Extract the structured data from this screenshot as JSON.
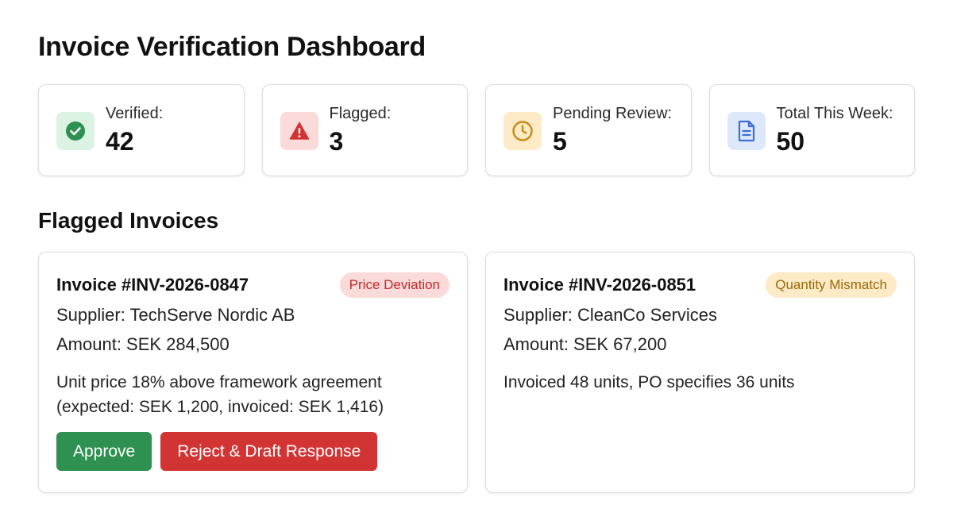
{
  "page": {
    "title": "Invoice Verification Dashboard"
  },
  "stats": [
    {
      "label": "Verified:",
      "value": "42",
      "icon": "check-circle-icon",
      "icon_bg": "#dcf2e3",
      "icon_color": "#2e9152"
    },
    {
      "label": "Flagged:",
      "value": "3",
      "icon": "warning-triangle-icon",
      "icon_bg": "#fbdada",
      "icon_color": "#d23434"
    },
    {
      "label": "Pending Review:",
      "value": "5",
      "icon": "clock-icon",
      "icon_bg": "#fdebc8",
      "icon_color": "#c88a12"
    },
    {
      "label": "Total This Week:",
      "value": "50",
      "icon": "document-icon",
      "icon_bg": "#dde8fb",
      "icon_color": "#3b6fd4"
    }
  ],
  "flagged": {
    "title": "Flagged Invoices",
    "invoices": [
      {
        "number": "Invoice #INV-2026-0847",
        "badge": "Price Deviation",
        "supplier": "Supplier: TechServe Nordic AB",
        "amount": "Amount: SEK 284,500",
        "desc_line1": "Unit price 18% above framework agreement",
        "desc_line2": "(expected: SEK 1,200, invoiced: SEK 1,416)",
        "approve_label": "Approve",
        "reject_label": "Reject & Draft Response"
      },
      {
        "number": "Invoice #INV-2026-0851",
        "badge": "Quantity Mismatch",
        "supplier": "Supplier: CleanCo Services",
        "amount": "Amount: SEK 67,200",
        "desc_line1": "Invoiced 48 units, PO specifies 36 units"
      }
    ]
  }
}
